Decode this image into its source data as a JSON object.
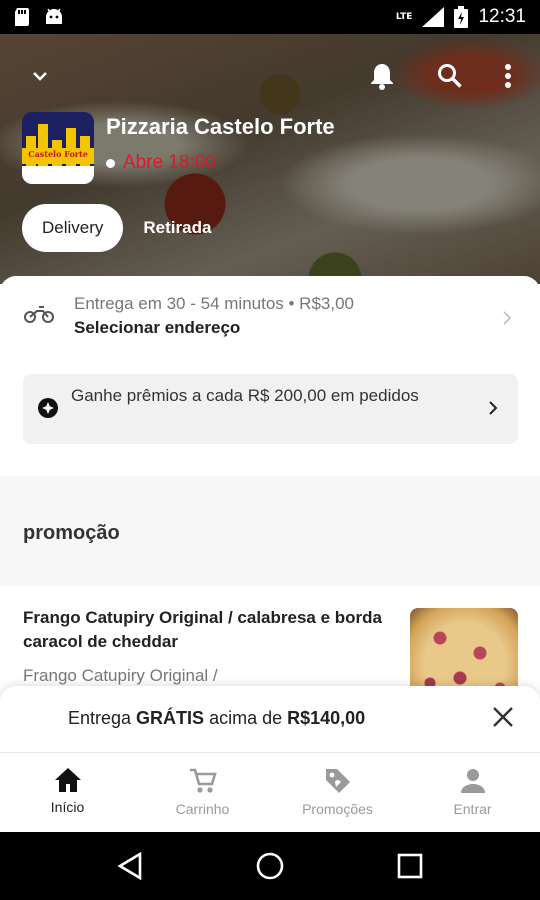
{
  "status_bar": {
    "time": "12:31",
    "network": "LTE",
    "icons": [
      "sd-card-icon",
      "android-icon",
      "signal-icon",
      "battery-icon"
    ]
  },
  "header": {
    "icons": [
      "chevron-down-icon",
      "bell-icon",
      "search-icon",
      "more-vert-icon"
    ],
    "store_name": "Pizzaria Castelo Forte",
    "store_status": "Abre 18:00",
    "logo_text": "Castelo Forte",
    "tabs": [
      {
        "label": "Delivery",
        "active": true
      },
      {
        "label": "Retirada",
        "active": false
      }
    ]
  },
  "delivery": {
    "line1": "Entrega em 30 - 54 minutos • R$3,00",
    "line2": "Selecionar endereço"
  },
  "reward": {
    "text": "Ganhe prêmios a cada R$ 200,00 em pedidos"
  },
  "section": {
    "title": "promoção"
  },
  "product": {
    "title": "Frango Catupiry Original / calabresa e borda caracol de cheddar",
    "description": "Frango Catupiry Original /"
  },
  "free_delivery": {
    "prefix": "Entrega ",
    "highlight": "GRÁTIS",
    "middle": " acima de ",
    "amount": "R$140,00"
  },
  "bottom_nav": [
    {
      "label": "Início",
      "icon": "home-icon",
      "active": true
    },
    {
      "label": "Carrinho",
      "icon": "cart-icon",
      "active": false
    },
    {
      "label": "Promoções",
      "icon": "tag-icon",
      "active": false
    },
    {
      "label": "Entrar",
      "icon": "person-icon",
      "active": false
    }
  ],
  "colors": {
    "accent_red": "#e0162b",
    "nav_inactive": "#9a9a9a"
  }
}
